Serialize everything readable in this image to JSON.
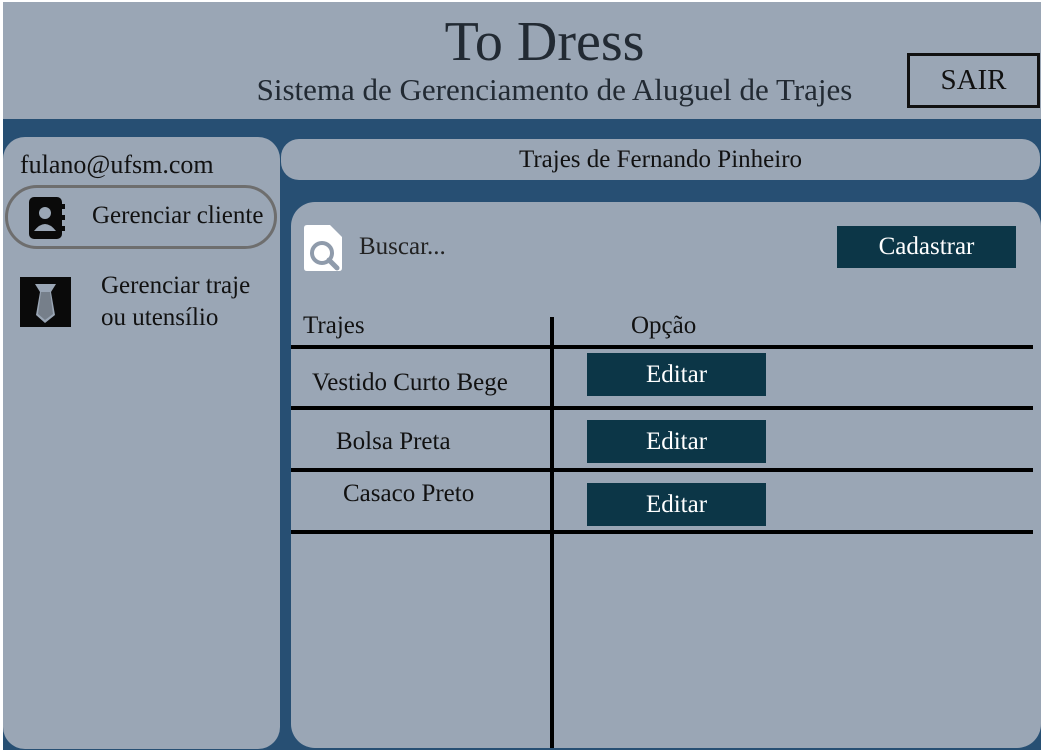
{
  "app": {
    "title": "To Dress",
    "subtitle": "Sistema de Gerenciamento de Aluguel de Trajes",
    "logout_label": "SAIR"
  },
  "sidebar": {
    "user_email": "fulano@ufsm.com",
    "items": [
      {
        "label": "Gerenciar cliente",
        "icon": "contact-book-icon"
      },
      {
        "label": "Gerenciar traje ou utensílio",
        "icon": "tie-icon"
      }
    ]
  },
  "main": {
    "page_title": "Trajes de Fernando Pinheiro",
    "search": {
      "placeholder": "Buscar..."
    },
    "register_label": "Cadastrar",
    "table": {
      "columns": [
        "Trajes",
        "Opção"
      ],
      "rows": [
        {
          "name": "Vestido Curto Bege",
          "action": "Editar"
        },
        {
          "name": "Bolsa Preta",
          "action": "Editar"
        },
        {
          "name": "Casaco Preto",
          "action": "Editar"
        }
      ]
    }
  },
  "colors": {
    "background": "#274f73",
    "panel": "#9aa6b5",
    "button": "#0c3647",
    "button_text": "#ffffff"
  }
}
